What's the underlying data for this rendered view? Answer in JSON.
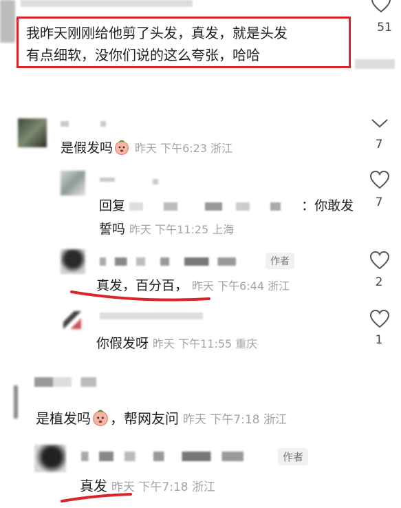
{
  "top_comment": {
    "text_line1": "我昨天刚刚给他剪了头发，真发，就是头发",
    "text_line2": "有点细软，没你们说的这么夸张，哈哈",
    "likes": "51"
  },
  "comments": [
    {
      "text": "是假发吗",
      "meta": "昨天 下午6:23 浙江",
      "likes": "7",
      "replies": [
        {
          "reply_prefix": "回复",
          "text_tail": "：你敢发",
          "text_line2": "誓吗",
          "meta": "昨天 下午11:25 上海",
          "likes": "7"
        },
        {
          "author_tag": "作者",
          "text": "真发，百分百，",
          "meta": "昨天 下午6:44 浙江",
          "likes": "2"
        },
        {
          "text": "你假发呀",
          "meta": "昨天 下午11:55 重庆",
          "likes": "1"
        }
      ]
    },
    {
      "text": "是植发吗",
      "text_tail": "，帮网友问",
      "meta": "昨天 下午7:18 浙江",
      "replies": [
        {
          "author_tag": "作者",
          "text": "真发",
          "meta": "昨天 下午7:18 浙江"
        }
      ]
    }
  ],
  "colors": {
    "highlight_red": "#d9252a",
    "meta_gray": "#a3a3a3"
  },
  "icons": [
    "heart-icon",
    "chevron-down-icon",
    "emoji-face-icon"
  ]
}
